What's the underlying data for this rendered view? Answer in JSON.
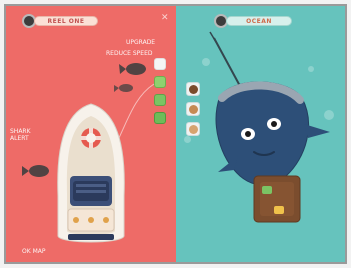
{
  "left_panel": {
    "hud_label": "REEL ONE",
    "callout_top": "UPGRADE",
    "callout_sub": "REDUCE SPEED",
    "callout_side": "SHARK\nALERT",
    "bottom_label": "OK MAP",
    "colors": {
      "background": "#ee6b67"
    }
  },
  "right_panel": {
    "hud_label": "OCEAN",
    "colors": {
      "background": "#66c3bd"
    }
  }
}
